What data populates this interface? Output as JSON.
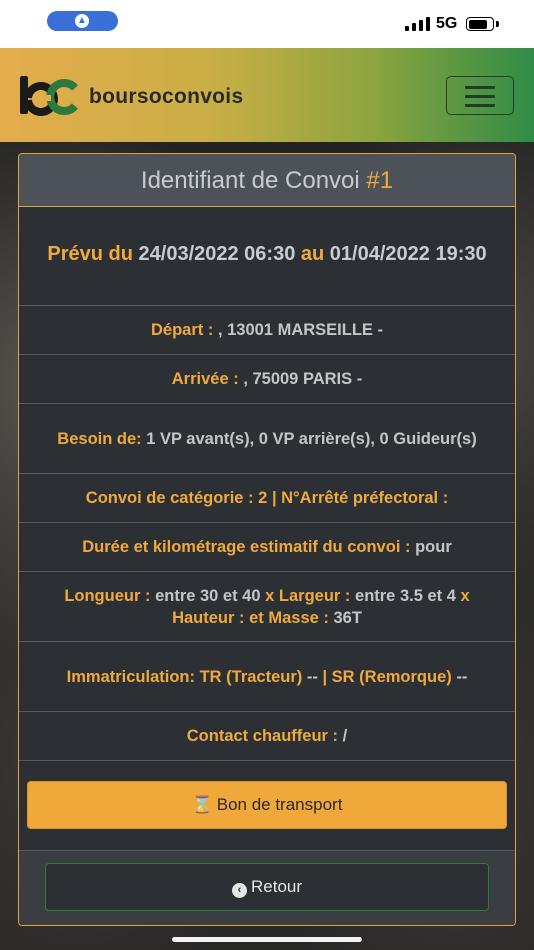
{
  "status_bar": {
    "network": "5G"
  },
  "header": {
    "brand": "boursoconvois"
  },
  "card": {
    "title_text": "Identifiant de Convoi",
    "title_number": "#1",
    "schedule": {
      "label": "Prévu du",
      "start": "24/03/2022 06:30",
      "connector": "au",
      "end": "01/04/2022 19:30"
    },
    "departure": {
      "label": "Départ :",
      "value": ", 13001 MARSEILLE -"
    },
    "arrival": {
      "label": "Arrivée :",
      "value": ", 75009 PARIS -"
    },
    "needs": {
      "label": "Besoin de:",
      "value": "1 VP avant(s), 0 VP arrière(s), 0 Guideur(s)"
    },
    "category": {
      "label": "Convoi de catégorie :",
      "value": "2",
      "separator": "| N°Arrêté préfectoral :"
    },
    "duration": {
      "label": "Durée et kilométrage estimatif du convoi :",
      "value": "pour"
    },
    "dimensions": {
      "length_label": "Longueur :",
      "length_value": "entre 30 et 40",
      "width_label": "x Largeur :",
      "width_value": "entre 3.5 et 4",
      "height_label": "x Hauteur :",
      "mass_label": "et Masse :",
      "mass_value": "36T"
    },
    "registration": {
      "label": "Immatriculation: TR (Tracteur)",
      "tr_value": "--",
      "sr_label": "| SR (Remorque)",
      "sr_value": "--"
    },
    "contact": {
      "label": "Contact chauffeur :",
      "value": "/"
    },
    "transport_button": "Bon de transport",
    "back_button": "Retour"
  },
  "colors": {
    "accent": "#f0a93c",
    "header_gradient_start": "#e4ad4c",
    "header_gradient_end": "#2f8c46",
    "card_bg": "#2c3034",
    "retour_border": "#2e7a3e"
  },
  "icons": {
    "transport": "hourglass-icon",
    "back": "chevron-circle-left-icon"
  }
}
